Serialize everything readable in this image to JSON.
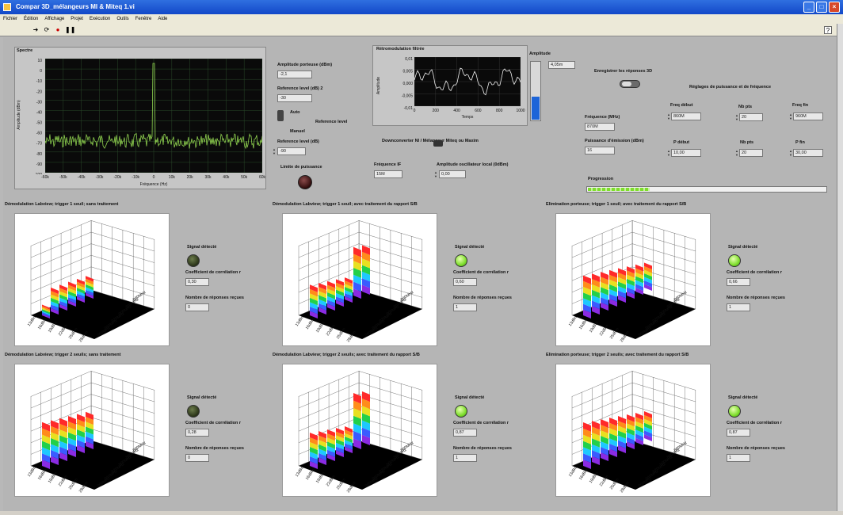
{
  "window": {
    "title": "Compar 3D_mélangeurs MI & Miteq 1.vi",
    "menu": [
      "Fichier",
      "Édition",
      "Affichage",
      "Projet",
      "Exécution",
      "Outils",
      "Fenêtre",
      "Aide"
    ]
  },
  "spectre": {
    "title": "Spectre",
    "ylabel": "Amplitude (dBm)",
    "xlabel": "Fréquence (Hz)",
    "yticks": [
      "10",
      "0",
      "-10",
      "-20",
      "-30",
      "-40",
      "-50",
      "-60",
      "-70",
      "-80",
      "-90",
      "-100"
    ],
    "xticks": [
      "-60k",
      "-50k",
      "-40k",
      "-30k",
      "-20k",
      "-10k",
      "0",
      "10k",
      "20k",
      "30k",
      "40k",
      "50k",
      "60k"
    ]
  },
  "controls": {
    "amp_porteuse_label": "Amplitude porteuse (dBm)",
    "amp_porteuse_value": "-2,1",
    "ref_level2_label": "Reference level (dB) 2",
    "ref_level2_value": "-30",
    "auto_label": "Auto",
    "manuel_label": "Manuel",
    "ref_level_switch_label": "Reference level",
    "ref_level_label": "Reference level (dB)",
    "ref_level_value": "-90",
    "limite_label": "Limite de puissance",
    "freq_if_label": "Fréquence IF",
    "freq_if_value": "15M",
    "amp_ol_label": "Amplitude oscillateur local (0dBm)",
    "amp_ol_value": "0,00",
    "downconv_label": "Downconverter NI / Mélangeur Miteq ou Maxim"
  },
  "retro": {
    "title": "Rétromodulation filtrée",
    "ylabel": "Amplitude",
    "xlabel": "Temps",
    "yticks": [
      "0,01",
      "0,005",
      "0,000",
      "-0,005",
      "-0,01"
    ],
    "xticks": [
      "0",
      "200",
      "400",
      "600",
      "800",
      "1000"
    ]
  },
  "amplitude_meter": {
    "label": "Amplitude",
    "value": "4,05m",
    "fill_fraction": 0.4
  },
  "settings": {
    "enregistrer_label": "Enregistrer les réponses 3D",
    "reglages_label": "Réglages de puissance et de fréquence",
    "frequence_label": "Fréquence (MHz)",
    "frequence_value": "870M",
    "freq_debut_label": "Freq début",
    "freq_debut_value": "860M",
    "nb_pts1_label": "Nb pts",
    "nb_pts1_value": "20",
    "freq_fin_label": "Freq fin",
    "freq_fin_value": "960M",
    "puissance_label": "Puissance d'émission (dBm)",
    "puissance_value": "16",
    "p_debut_label": "P début",
    "p_debut_value": "10,00",
    "nb_pts2_label": "Nb pts",
    "nb_pts2_value": "20",
    "p_fin_label": "P fin",
    "p_fin_value": "30,00",
    "progression_label": "Progression",
    "progression_fraction": 0.26
  },
  "panels": [
    {
      "title": "Démodulation Labview; trigger 1 seuil; sans traitement",
      "signal_label": "Signal détecté",
      "signal_on": false,
      "corr_label": "Coefficient de corrélation r",
      "corr_value": "0,30",
      "rep_label": "Nombre de réponses reçues",
      "rep_value": "0"
    },
    {
      "title": "Démodulation Labview; trigger 1 seuil; avec traitement du rapport S/B",
      "signal_label": "Signal détecté",
      "signal_on": true,
      "corr_label": "Coefficient de corrélation r",
      "corr_value": "0,60",
      "rep_label": "Nombre de réponses reçues",
      "rep_value": "1"
    },
    {
      "title": "Elimination porteuse; trigger 1 seuil; avec traitement du rapport S/B",
      "signal_label": "Signal détecté",
      "signal_on": true,
      "corr_label": "Coefficient de corrélation r",
      "corr_value": "0,66",
      "rep_label": "Nombre de réponses reçues",
      "rep_value": "1"
    },
    {
      "title": "Démodulation Labview; trigger 2 seuils; sans traitement",
      "signal_label": "Signal détecté",
      "signal_on": false,
      "corr_label": "Coefficient de corrélation r",
      "corr_value": "0,28",
      "rep_label": "Nombre de réponses reçues",
      "rep_value": "0"
    },
    {
      "title": "Démodulation Labview; trigger 2 seuils; avec traitement du rapport S/B",
      "signal_label": "Signal détecté",
      "signal_on": true,
      "corr_label": "Coefficient de corrélation r",
      "corr_value": "0,87",
      "rep_label": "Nombre de réponses reçues",
      "rep_value": "1"
    },
    {
      "title": "Elimination porteuse; trigger 2 seuils; avec traitement du rapport S/B",
      "signal_label": "Signal détecté",
      "signal_on": true,
      "corr_label": "Coefficient de corrélation r",
      "corr_value": "0,87",
      "rep_label": "Nombre de réponses reçues",
      "rep_value": "1"
    }
  ],
  "axis3d": {
    "power_ticks": [
      "13dBm",
      "16dBm",
      "19dBm",
      "22dBm",
      "25dBm",
      "28dBm"
    ],
    "freq_ticks": [
      "860MHz",
      "880MHz",
      "900MHz",
      "920MHz",
      "940MHz",
      "960MHz"
    ]
  },
  "colors": {
    "panel_bg": "#b5b5b5",
    "plot_bg": "#0a0a0a",
    "trace_green": "#8fd14f",
    "led_on": "#7ede2c",
    "led_off": "#3a4622",
    "meter_blue": "#1c64d8"
  }
}
